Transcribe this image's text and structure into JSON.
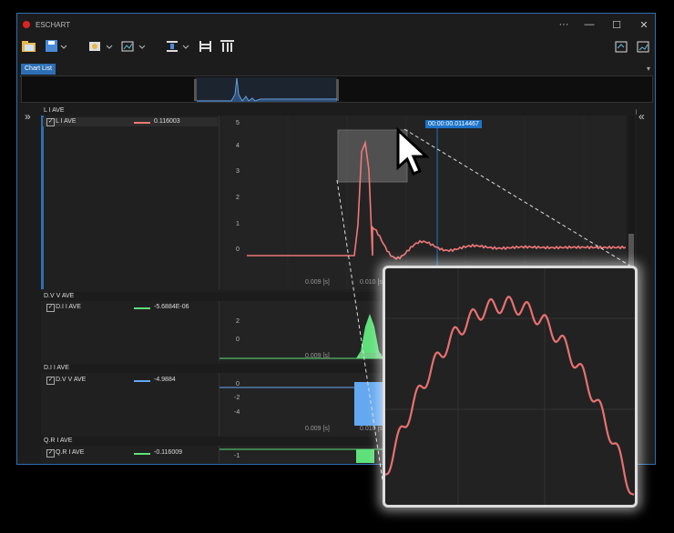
{
  "app": {
    "title": "ESCHART"
  },
  "window_buttons": {
    "more": "···",
    "minimize": "—",
    "maximize": "☐",
    "close": "✕"
  },
  "tabs": [
    {
      "label": "Chart List"
    }
  ],
  "toolbar": {
    "left_icons": [
      "open-folder-icon",
      "save-icon",
      "image-export-icon",
      "chart-settings-icon",
      "align-icon",
      "columns-icon",
      "table-icon"
    ],
    "right_icons": [
      "export-chart-icon",
      "export-image-icon"
    ]
  },
  "panes": [
    {
      "header": "L I AVE",
      "legend_name": "L I AVE",
      "legend_value": "0.116003",
      "color": "#f07878",
      "y_ticks": [
        "5",
        "4",
        "3",
        "2",
        "1",
        "0"
      ]
    },
    {
      "header": "D.V V AVE",
      "legend_name": "D.I I AVE",
      "legend_value": "-5.6884E-06",
      "color": "#5fe07a",
      "y_ticks": [
        "2",
        "0"
      ]
    },
    {
      "header": "D.I I AVE",
      "legend_name": "D.V V AVE",
      "legend_value": "-4.9884",
      "color": "#64a8f0",
      "y_ticks": [
        "0",
        "-2",
        "-4"
      ]
    },
    {
      "header": "Q.R I AVE",
      "legend_name": "Q.R I AVE",
      "legend_value": "-0.116009",
      "color": "#5fe07a",
      "y_ticks": [
        "-1"
      ]
    }
  ],
  "x_ticks": [
    "0.009 [s]",
    "0.010 [s]"
  ],
  "cursor": {
    "time": "00:00:00.0114467"
  },
  "colors": {
    "accent": "#2d6fb5",
    "cursor": "#1e73c8"
  }
}
